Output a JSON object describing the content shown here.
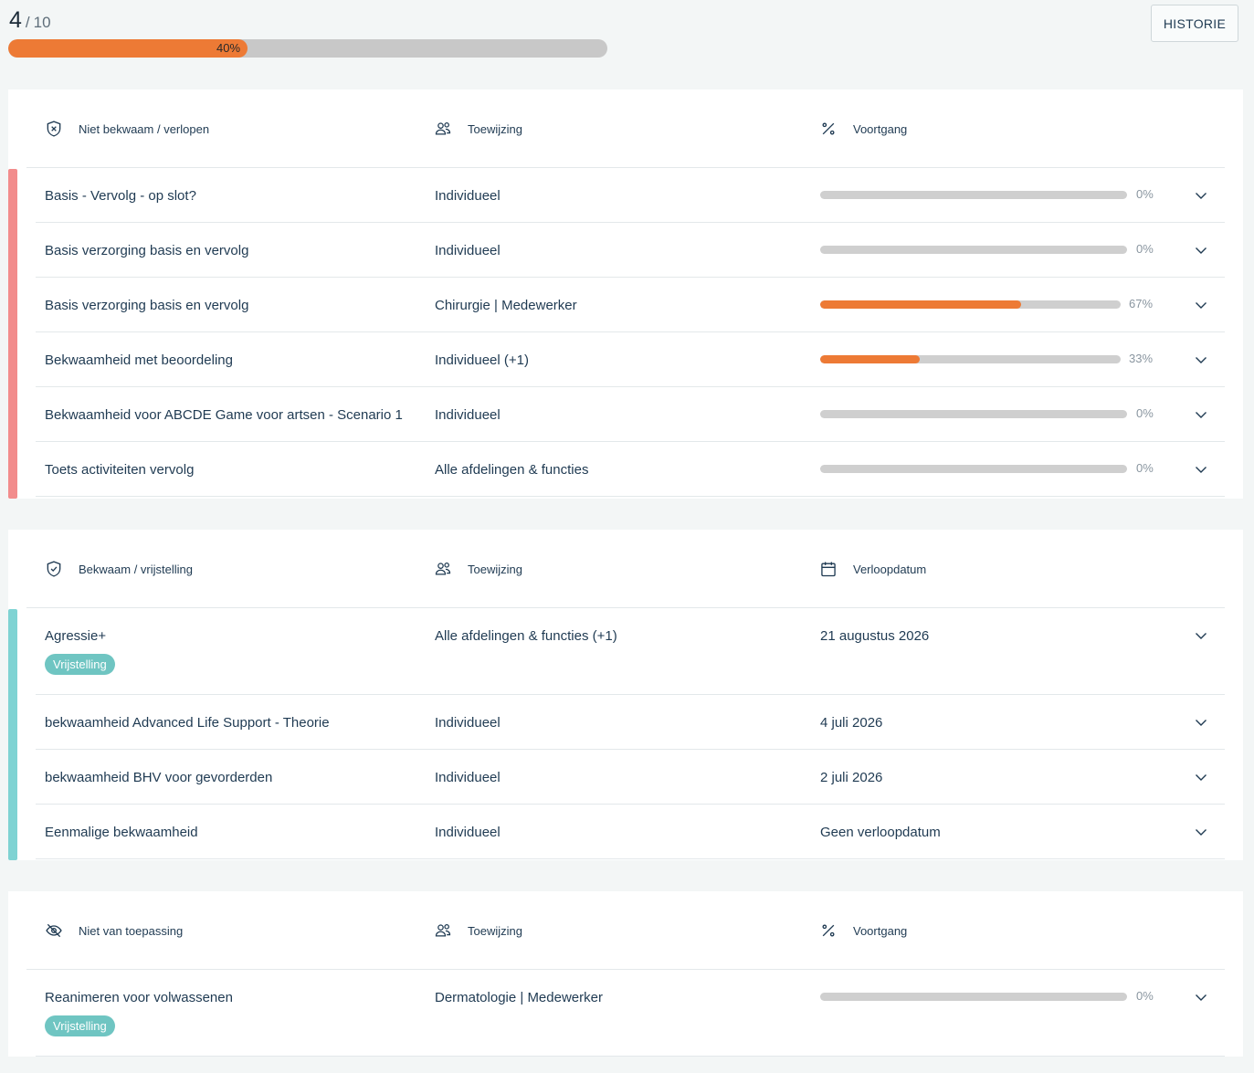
{
  "header": {
    "current": "4",
    "slash": "/",
    "total": "10",
    "progress_label": "40%",
    "progress_value": 0.4,
    "historie_label": "HISTORIE"
  },
  "colors": {
    "accent": "#ed7a35",
    "track": "#c8c8c8",
    "not_competent": "#f28c8c",
    "competent": "#7fd3d3",
    "badge": "#6fc5c2"
  },
  "sections": [
    {
      "status_label": "Niet bekwaam / verlopen",
      "status_icon": "shield-x-icon",
      "assign_label": "Toewijzing",
      "third_label": "Voortgang",
      "third_icon": "percent-icon",
      "rows": [
        {
          "name": "Basis - Vervolg - op slot?",
          "assign": "Individueel",
          "progress": 0,
          "pct": "0%"
        },
        {
          "name": "Basis verzorging basis en vervolg",
          "assign": "Individueel",
          "progress": 0,
          "pct": "0%"
        },
        {
          "name": "Basis verzorging basis en vervolg",
          "assign": "Chirurgie | Medewerker",
          "progress": 0.67,
          "pct": "67%"
        },
        {
          "name": "Bekwaamheid met beoordeling",
          "assign": "Individueel (+1)",
          "progress": 0.33,
          "pct": "33%"
        },
        {
          "name": "Bekwaamheid voor ABCDE Game voor artsen - Scenario 1",
          "assign": "Individueel",
          "progress": 0,
          "pct": "0%"
        },
        {
          "name": "Toets activiteiten vervolg",
          "assign": "Alle afdelingen & functies",
          "progress": 0,
          "pct": "0%"
        }
      ]
    },
    {
      "status_label": "Bekwaam / vrijstelling",
      "status_icon": "shield-check-icon",
      "assign_label": "Toewijzing",
      "third_label": "Verloopdatum",
      "third_icon": "calendar-icon",
      "rows": [
        {
          "name": "Agressie+",
          "badge": "Vrijstelling",
          "assign": "Alle afdelingen & functies (+1)",
          "date": "21 augustus 2026"
        },
        {
          "name": "bekwaamheid Advanced Life Support - Theorie",
          "assign": "Individueel",
          "date": "4 juli 2026"
        },
        {
          "name": "bekwaamheid BHV voor gevorderden",
          "assign": "Individueel",
          "date": "2 juli 2026"
        },
        {
          "name": "Eenmalige bekwaamheid",
          "assign": "Individueel",
          "date": "Geen verloopdatum"
        }
      ]
    },
    {
      "status_label": "Niet van toepassing",
      "status_icon": "eye-off-icon",
      "assign_label": "Toewijzing",
      "third_label": "Voortgang",
      "third_icon": "percent-icon",
      "rows": [
        {
          "name": "Reanimeren voor volwassenen",
          "badge": "Vrijstelling",
          "assign": "Dermatologie | Medewerker",
          "progress": 0,
          "pct": "0%"
        }
      ]
    }
  ]
}
